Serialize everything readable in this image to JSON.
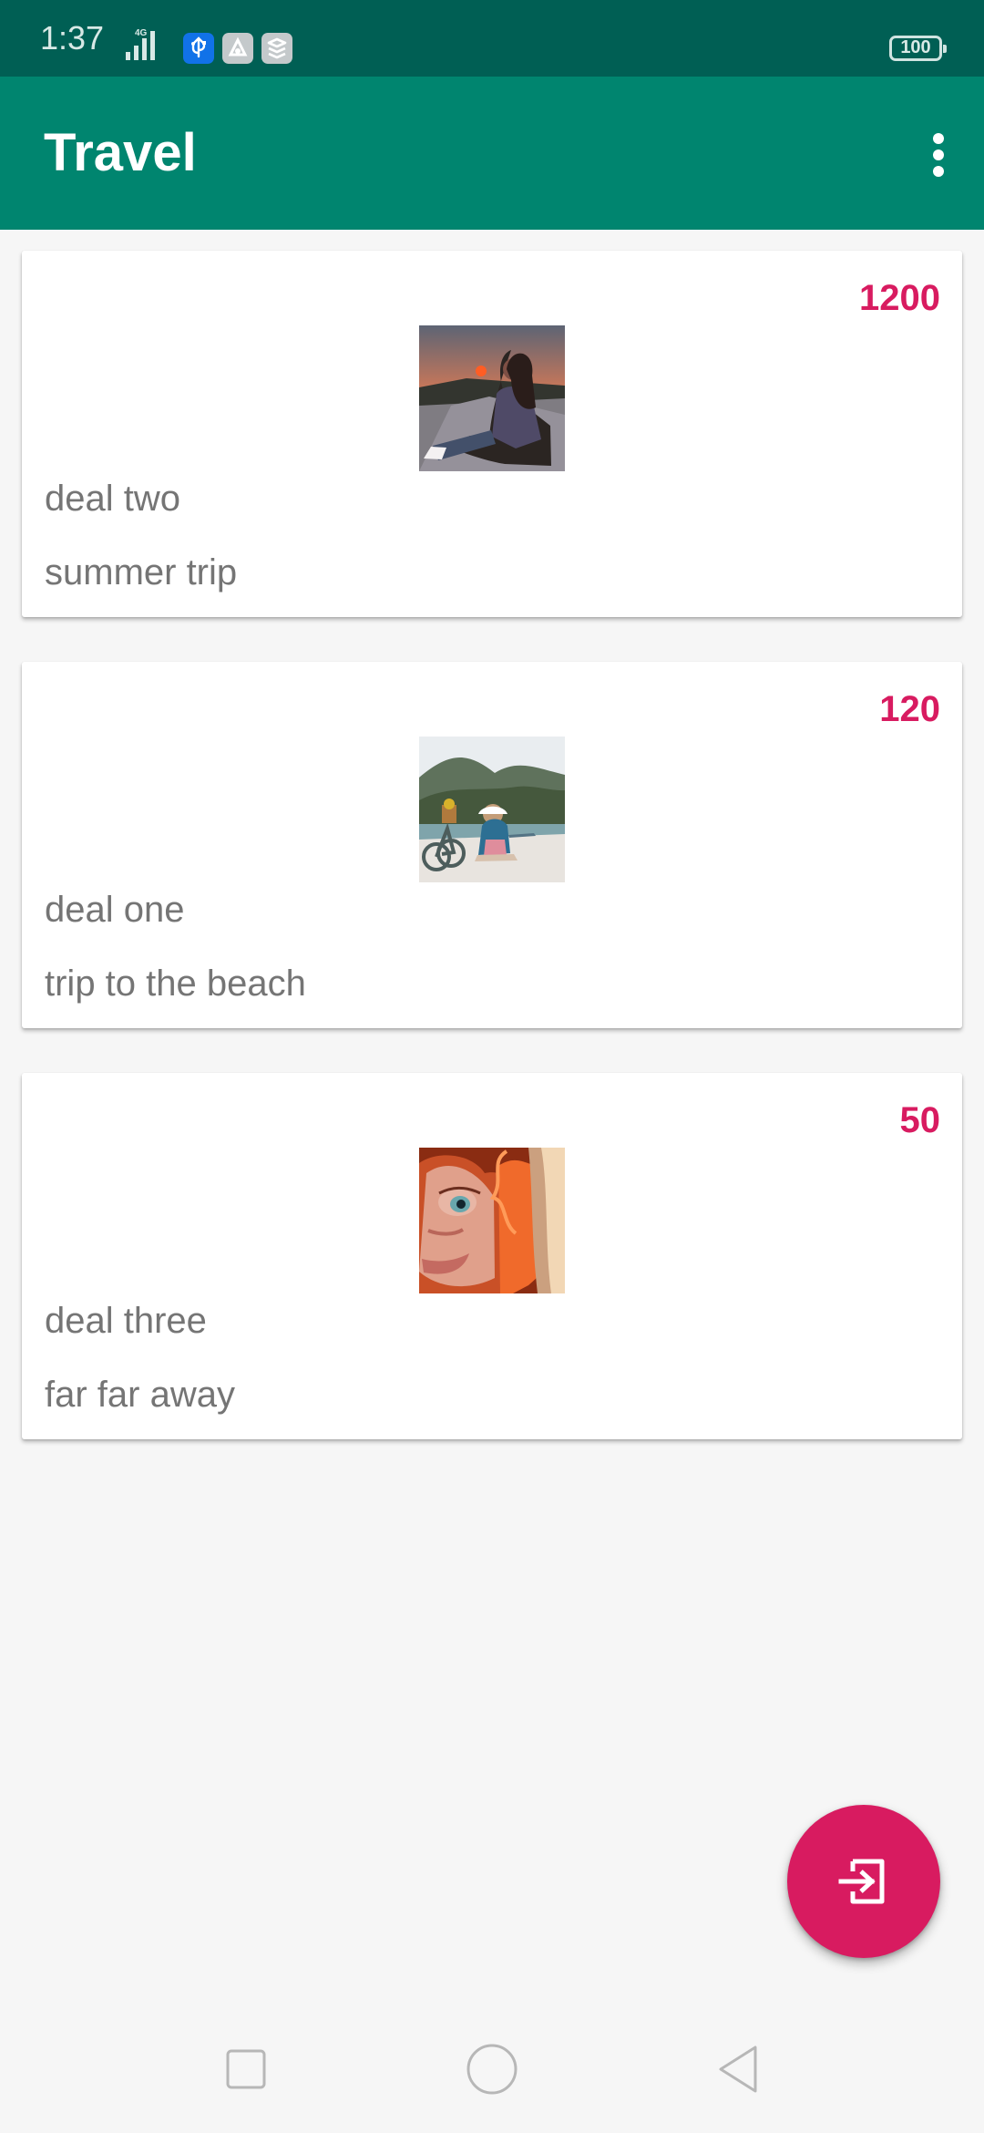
{
  "status_bar": {
    "time": "1:37",
    "network": "4G",
    "battery": "100",
    "icons": [
      "usb-icon",
      "app-icon",
      "stack-icon"
    ]
  },
  "app_bar": {
    "title": "Travel",
    "menu_icon": "more-vertical-icon"
  },
  "deals": [
    {
      "price": "1200",
      "name": "deal two",
      "description": "summer trip",
      "image": "sunset-road-photo"
    },
    {
      "price": "120",
      "name": "deal one",
      "description": "trip to the beach",
      "image": "beach-bike-photo"
    },
    {
      "price": "50",
      "name": "deal three",
      "description": "far far away",
      "image": "red-curly-hair-character-photo"
    }
  ],
  "fab": {
    "icon": "logout-icon"
  },
  "navigation": {
    "items": [
      "recent-apps-icon",
      "home-icon",
      "back-icon"
    ]
  },
  "colors": {
    "status_bar": "#005f54",
    "app_bar": "#00856f",
    "accent": "#d81b60",
    "text": "#757575",
    "background": "#f6f6f6"
  }
}
